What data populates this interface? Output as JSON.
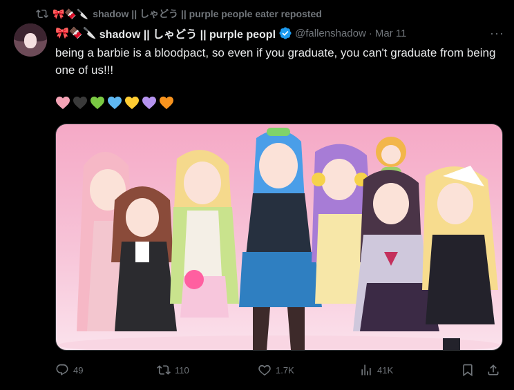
{
  "repost": {
    "emojis": "🎀🍫🔪",
    "text": "shadow || しゃどう || purple people eater reposted"
  },
  "tweet": {
    "name_emojis": "🎀🍫🔪",
    "display_name": "shadow || しゃどう || purple peopl",
    "handle": "@fallenshadow",
    "separator": "·",
    "date": "Mar 11",
    "more": "···",
    "text": "being a barbie is a bloodpact, so even if you graduate, you can't graduate from being one of us!!!",
    "hearts": [
      {
        "name": "pink",
        "color": "#f4a3b6"
      },
      {
        "name": "black",
        "color": "#3a3a3a"
      },
      {
        "name": "green",
        "color": "#7ac943"
      },
      {
        "name": "blue",
        "color": "#5fb8f2"
      },
      {
        "name": "yellow",
        "color": "#ffcc33"
      },
      {
        "name": "purple",
        "color": "#b593ef"
      },
      {
        "name": "orange",
        "color": "#f7931e"
      }
    ]
  },
  "actions": {
    "replies": "49",
    "reposts": "110",
    "likes": "1.7K",
    "views": "41K"
  },
  "colors": {
    "background": "#000000",
    "text": "#e7e9ea",
    "muted": "#71767b",
    "verified": "#1d9bf0",
    "border": "#2f3336"
  }
}
